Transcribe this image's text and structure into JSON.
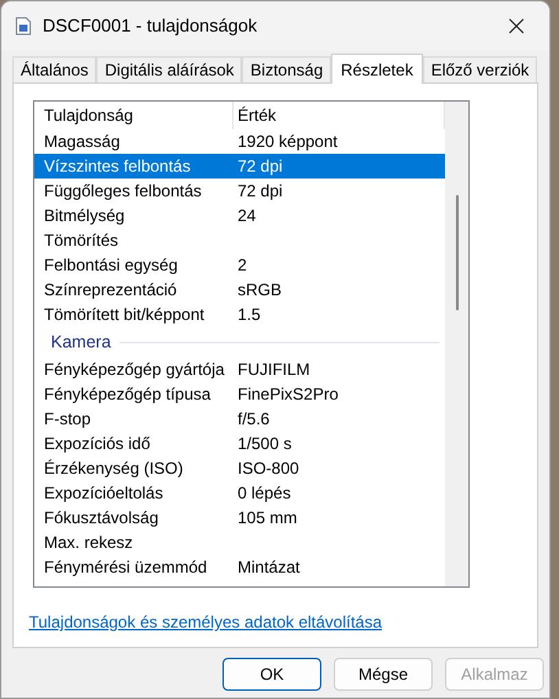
{
  "window": {
    "title": "DSCF0001 - tulajdonságok"
  },
  "tabs": [
    {
      "label": "Általános",
      "selected": false
    },
    {
      "label": "Digitális aláírások",
      "selected": false
    },
    {
      "label": "Biztonság",
      "selected": false
    },
    {
      "label": "Részletek",
      "selected": true
    },
    {
      "label": "Előző verziók",
      "selected": false
    }
  ],
  "table": {
    "columns": [
      "Tulajdonság",
      "Érték"
    ],
    "rows": [
      {
        "kind": "row",
        "name": "Magasság",
        "value": "1920 képpont",
        "selected": false
      },
      {
        "kind": "row",
        "name": "Vízszintes felbontás",
        "value": "72 dpi",
        "selected": true
      },
      {
        "kind": "row",
        "name": "Függőleges felbontás",
        "value": "72 dpi",
        "selected": false
      },
      {
        "kind": "row",
        "name": "Bitmélység",
        "value": "24",
        "selected": false
      },
      {
        "kind": "row",
        "name": "Tömörítés",
        "selected": false
      },
      {
        "kind": "row",
        "name": "Felbontási egység",
        "value": "2",
        "selected": false
      },
      {
        "kind": "row",
        "name": "Színreprezentáció",
        "value": "sRGB",
        "selected": false
      },
      {
        "kind": "row",
        "name": "Tömörített bit/képpont",
        "value": "1.5",
        "selected": false
      },
      {
        "kind": "group",
        "name": "Kamera"
      },
      {
        "kind": "row",
        "name": "Fényképezőgép gyártója",
        "value": "FUJIFILM",
        "selected": false
      },
      {
        "kind": "row",
        "name": "Fényképezőgép típusa",
        "value": "FinePixS2Pro",
        "selected": false
      },
      {
        "kind": "row",
        "name": "F-stop",
        "value": "f/5.6",
        "selected": false
      },
      {
        "kind": "row",
        "name": "Expozíciós idő",
        "value": "1/500 s",
        "selected": false
      },
      {
        "kind": "row",
        "name": "Érzékenység (ISO)",
        "value": "ISO-800",
        "selected": false
      },
      {
        "kind": "row",
        "name": "Expozícióeltolás",
        "value": "0 lépés",
        "selected": false
      },
      {
        "kind": "row",
        "name": "Fókusztávolság",
        "value": "105 mm",
        "selected": false
      },
      {
        "kind": "row",
        "name": "Max. rekesz",
        "selected": false
      },
      {
        "kind": "row",
        "name": "Fénymérési üzemmód",
        "value": "Mintázat",
        "selected": false
      }
    ]
  },
  "link": "Tulajdonságok és személyes adatok eltávolítása",
  "buttons": [
    {
      "label": "OK",
      "default": true,
      "disabled": false
    },
    {
      "label": "Mégse",
      "default": false,
      "disabled": false
    },
    {
      "label": "Alkalmaz",
      "default": false,
      "disabled": true
    }
  ]
}
